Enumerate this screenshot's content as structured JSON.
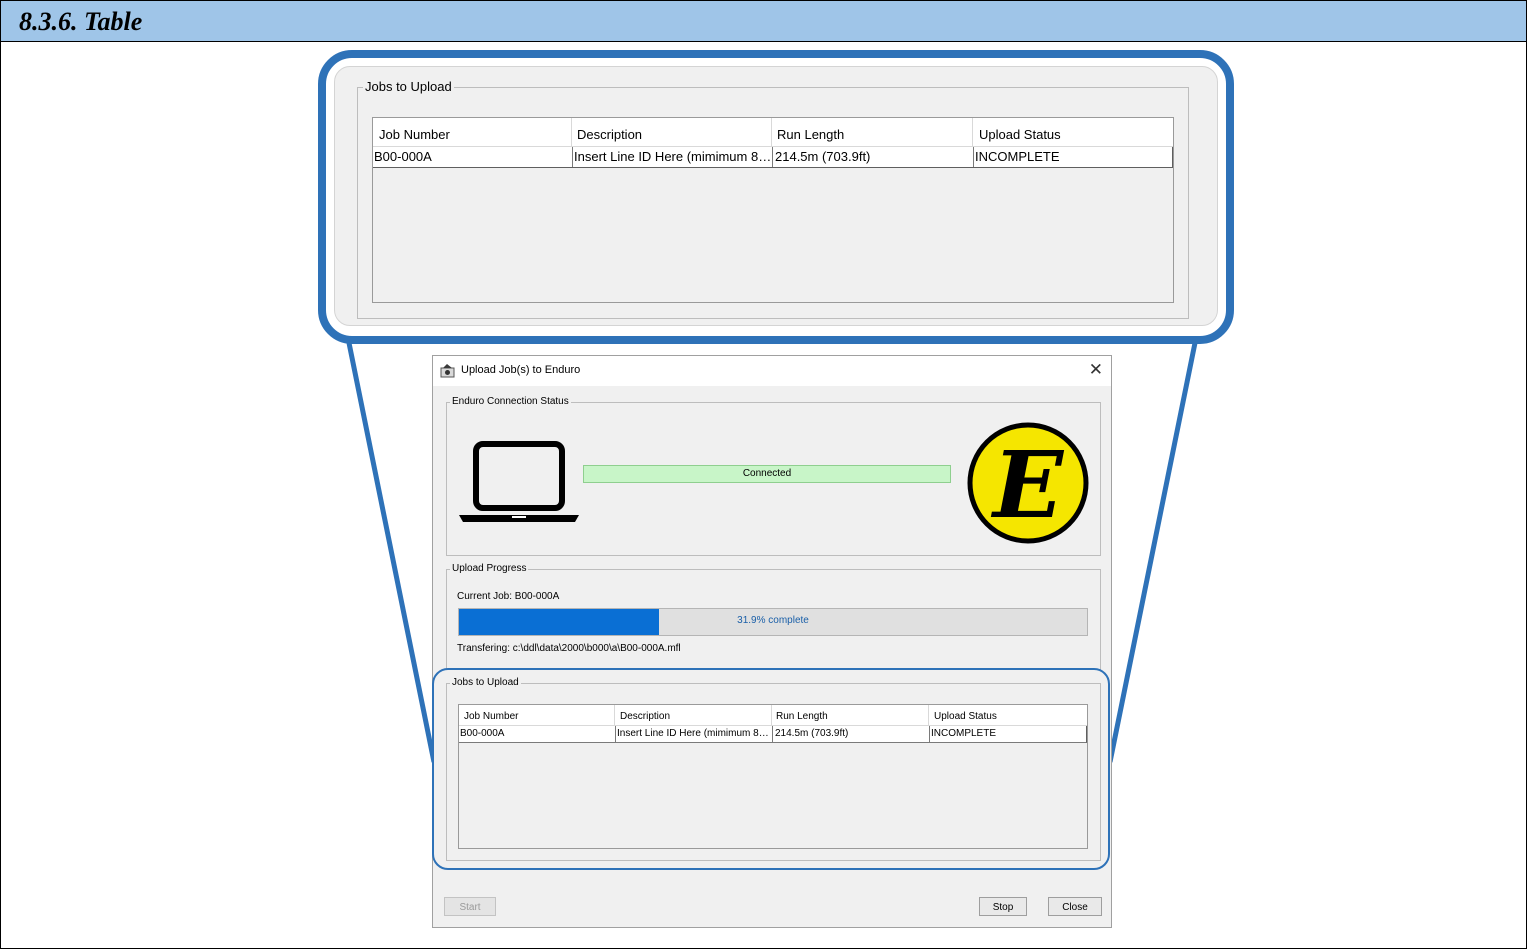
{
  "section_heading": "8.3.6. Table",
  "zoom_panel": {
    "legend": "Jobs to Upload",
    "columns": [
      "Job Number",
      "Description",
      "Run Length",
      "Upload Status"
    ],
    "rows": [
      {
        "job_number": "B00-000A",
        "description": "Insert Line ID Here (mimimum 8…",
        "run_length": "214.5m (703.9ft)",
        "upload_status": "INCOMPLETE"
      }
    ]
  },
  "dialog": {
    "title": "Upload Job(s) to Enduro",
    "close_icon": "close-icon",
    "connection": {
      "legend": "Enduro Connection Status",
      "status_text": "Connected",
      "status_color": "#c8f5c8",
      "computer_icon": "laptop-icon",
      "logo_letter": "E",
      "logo_color": "#f5e600"
    },
    "upload_progress": {
      "legend": "Upload Progress",
      "current_job_label": "Current Job:  B00-000A",
      "percent": 31.9,
      "progress_text": "31.9% complete",
      "fill_color": "#0a6fd4",
      "transfer_text": "Transfering: c:\\ddl\\data\\2000\\b000\\a\\B00-000A.mfl"
    },
    "jobs": {
      "legend": "Jobs to Upload",
      "columns": [
        "Job Number",
        "Description",
        "Run Length",
        "Upload Status"
      ],
      "rows": [
        {
          "job_number": "B00-000A",
          "description": "Insert Line ID Here (mimimum 8…",
          "run_length": "214.5m (703.9ft)",
          "upload_status": "INCOMPLETE"
        }
      ]
    },
    "buttons": {
      "start": "Start",
      "stop": "Stop",
      "close": "Close"
    }
  },
  "accent_color": "#2e72b8",
  "header_color": "#9fc5e8"
}
